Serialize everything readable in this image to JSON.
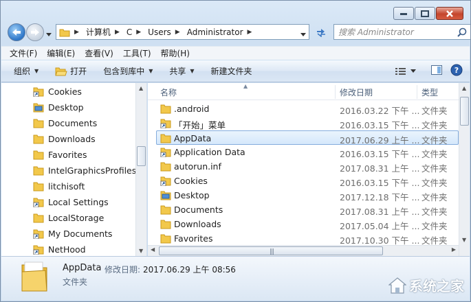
{
  "window": {
    "caption_buttons": [
      "minimize",
      "maximize",
      "close"
    ]
  },
  "address": {
    "crumbs": [
      "计算机",
      "C",
      "Users",
      "Administrator"
    ]
  },
  "search": {
    "placeholder": "搜索 Administrator"
  },
  "menubar": {
    "items": [
      "文件(F)",
      "编辑(E)",
      "查看(V)",
      "工具(T)",
      "帮助(H)"
    ]
  },
  "toolbar": {
    "organize": "组织",
    "open": "打开",
    "include": "包含到库中",
    "share": "共享",
    "new_folder": "新建文件夹"
  },
  "navpane": {
    "items": [
      {
        "label": "Cookies",
        "icon": "shortcut-folder-icon"
      },
      {
        "label": "Desktop",
        "icon": "desktop-folder-icon"
      },
      {
        "label": "Documents",
        "icon": "folder-icon"
      },
      {
        "label": "Downloads",
        "icon": "folder-icon"
      },
      {
        "label": "Favorites",
        "icon": "folder-icon"
      },
      {
        "label": "IntelGraphicsProfiles",
        "icon": "folder-icon"
      },
      {
        "label": "litchisoft",
        "icon": "folder-icon"
      },
      {
        "label": "Local Settings",
        "icon": "shortcut-folder-icon"
      },
      {
        "label": "LocalStorage",
        "icon": "folder-icon"
      },
      {
        "label": "My Documents",
        "icon": "shortcut-folder-icon"
      },
      {
        "label": "NetHood",
        "icon": "shortcut-folder-icon"
      }
    ]
  },
  "columns": {
    "name": "名称",
    "date": "修改日期",
    "type": "类型"
  },
  "files": [
    {
      "name": ".android",
      "date": "2016.03.22 下午 ...",
      "type": "文件夹",
      "icon": "folder-icon"
    },
    {
      "name": "「开始」菜单",
      "date": "2016.03.15 下午 ...",
      "type": "文件夹",
      "icon": "shortcut-folder-icon"
    },
    {
      "name": "AppData",
      "date": "2017.06.29 上午 ...",
      "type": "文件夹",
      "icon": "folder-icon",
      "selected": true
    },
    {
      "name": "Application Data",
      "date": "2016.03.15 下午 ...",
      "type": "文件夹",
      "icon": "shortcut-folder-icon"
    },
    {
      "name": "autorun.inf",
      "date": "2017.08.31 上午 ...",
      "type": "文件夹",
      "icon": "folder-icon"
    },
    {
      "name": "Cookies",
      "date": "2016.03.15 下午 ...",
      "type": "文件夹",
      "icon": "shortcut-folder-icon"
    },
    {
      "name": "Desktop",
      "date": "2017.12.18 下午 ...",
      "type": "文件夹",
      "icon": "desktop-folder-icon"
    },
    {
      "name": "Documents",
      "date": "2017.08.31 上午 ...",
      "type": "文件夹",
      "icon": "folder-icon"
    },
    {
      "name": "Downloads",
      "date": "2017.05.04 上午 ...",
      "type": "文件夹",
      "icon": "folder-icon"
    },
    {
      "name": "Favorites",
      "date": "2017.10.30 下午 ...",
      "type": "文件夹",
      "icon": "folder-icon"
    }
  ],
  "details": {
    "name": "AppData",
    "date_label": "修改日期:",
    "date_value": "2017.06.29 上午 08:56",
    "type": "文件夹"
  },
  "watermark": {
    "text": "系统之家"
  },
  "colors": {
    "folder": "#f2c84b",
    "selection_border": "#84acdd",
    "accent": "#2d76c8"
  }
}
